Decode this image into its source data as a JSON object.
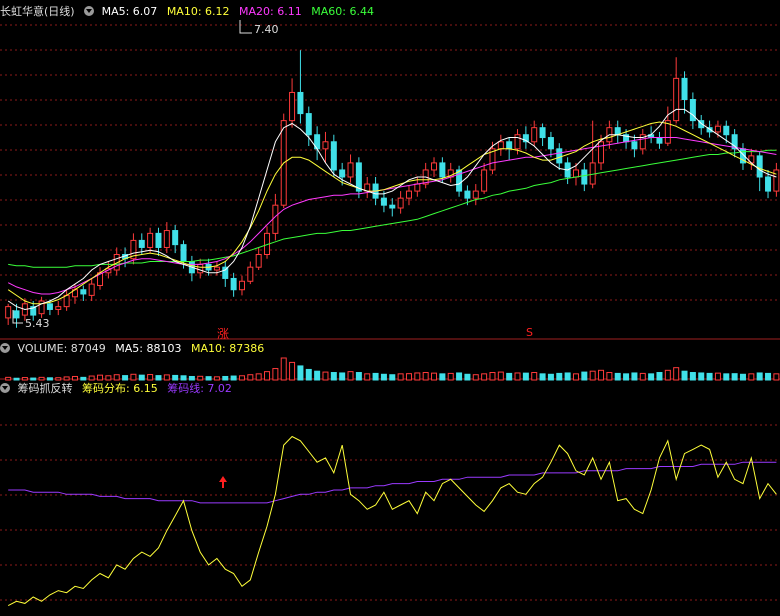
{
  "colors": {
    "up": "#ff3b3b",
    "down": "#40e0e8",
    "grid": "#8b1a1a",
    "ma5": "#ffffff",
    "ma10": "#ffff3a",
    "ma20": "#ff3aff",
    "ma60": "#3aff3a",
    "line_chip": "#ffff3a",
    "line_chipline": "#9a3aff",
    "label": "#dddddd",
    "signal": "#ff2020"
  },
  "price_panel": {
    "title": "长虹华意(日线)",
    "ma5_label": "MA5: 6.07",
    "ma10_label": "MA10: 6.12",
    "ma20_label": "MA20: 6.11",
    "ma60_label": "MA60: 6.44",
    "high_label": "7.40",
    "low_label": "5.43",
    "marker_zhang": "涨",
    "marker_s": "S"
  },
  "volume_panel": {
    "vol_label": "VOLUME: 87049",
    "ma5_label": "MA5: 88103",
    "ma10_label": "MA10: 87386"
  },
  "indicator_panel": {
    "name": "筹码抓反转",
    "chip_label": "筹码分布: 6.15",
    "chipline_label": "筹码线: 7.02"
  },
  "chart_data": {
    "type": "candlestick",
    "price_range": [
      5.4,
      7.6
    ],
    "candles": [
      [
        5.5,
        5.58,
        5.45,
        5.6
      ],
      [
        5.55,
        5.5,
        5.43,
        5.6
      ],
      [
        5.52,
        5.6,
        5.48,
        5.64
      ],
      [
        5.58,
        5.52,
        5.48,
        5.62
      ],
      [
        5.53,
        5.62,
        5.5,
        5.65
      ],
      [
        5.6,
        5.56,
        5.52,
        5.63
      ],
      [
        5.56,
        5.58,
        5.52,
        5.62
      ],
      [
        5.58,
        5.66,
        5.55,
        5.7
      ],
      [
        5.65,
        5.7,
        5.6,
        5.74
      ],
      [
        5.7,
        5.67,
        5.62,
        5.73
      ],
      [
        5.66,
        5.74,
        5.62,
        5.78
      ],
      [
        5.73,
        5.82,
        5.7,
        5.86
      ],
      [
        5.82,
        5.85,
        5.78,
        5.9
      ],
      [
        5.84,
        5.95,
        5.8,
        6.0
      ],
      [
        5.95,
        5.92,
        5.86,
        6.0
      ],
      [
        5.92,
        6.05,
        5.88,
        6.1
      ],
      [
        6.05,
        6.0,
        5.95,
        6.1
      ],
      [
        6.0,
        6.1,
        5.96,
        6.14
      ],
      [
        6.1,
        6.0,
        5.94,
        6.14
      ],
      [
        6.0,
        6.12,
        5.96,
        6.18
      ],
      [
        6.12,
        6.02,
        5.96,
        6.16
      ],
      [
        6.02,
        5.9,
        5.85,
        6.05
      ],
      [
        5.9,
        5.82,
        5.76,
        5.94
      ],
      [
        5.82,
        5.88,
        5.78,
        5.92
      ],
      [
        5.88,
        5.84,
        5.8,
        5.92
      ],
      [
        5.84,
        5.86,
        5.8,
        5.9
      ],
      [
        5.86,
        5.78,
        5.72,
        5.9
      ],
      [
        5.78,
        5.7,
        5.65,
        5.82
      ],
      [
        5.7,
        5.76,
        5.66,
        5.8
      ],
      [
        5.76,
        5.86,
        5.74,
        5.9
      ],
      [
        5.86,
        5.95,
        5.84,
        6.0
      ],
      [
        5.95,
        6.1,
        5.92,
        6.15
      ],
      [
        6.1,
        6.3,
        6.05,
        6.38
      ],
      [
        6.3,
        6.9,
        6.28,
        6.95
      ],
      [
        6.9,
        7.1,
        6.85,
        7.2
      ],
      [
        7.1,
        6.95,
        6.88,
        7.4
      ],
      [
        6.95,
        6.8,
        6.72,
        7.0
      ],
      [
        6.8,
        6.7,
        6.62,
        6.86
      ],
      [
        6.7,
        6.75,
        6.6,
        6.82
      ],
      [
        6.75,
        6.55,
        6.5,
        6.8
      ],
      [
        6.55,
        6.5,
        6.44,
        6.6
      ],
      [
        6.5,
        6.6,
        6.46,
        6.66
      ],
      [
        6.6,
        6.4,
        6.35,
        6.64
      ],
      [
        6.4,
        6.45,
        6.35,
        6.5
      ],
      [
        6.45,
        6.35,
        6.3,
        6.5
      ],
      [
        6.35,
        6.3,
        6.25,
        6.4
      ],
      [
        6.3,
        6.28,
        6.22,
        6.35
      ],
      [
        6.28,
        6.35,
        6.24,
        6.4
      ],
      [
        6.35,
        6.4,
        6.3,
        6.44
      ],
      [
        6.4,
        6.45,
        6.36,
        6.5
      ],
      [
        6.45,
        6.55,
        6.42,
        6.6
      ],
      [
        6.55,
        6.6,
        6.5,
        6.64
      ],
      [
        6.6,
        6.5,
        6.46,
        6.64
      ],
      [
        6.5,
        6.55,
        6.46,
        6.6
      ],
      [
        6.55,
        6.4,
        6.36,
        6.58
      ],
      [
        6.4,
        6.35,
        6.3,
        6.44
      ],
      [
        6.35,
        6.4,
        6.3,
        6.45
      ],
      [
        6.4,
        6.55,
        6.38,
        6.6
      ],
      [
        6.55,
        6.7,
        6.52,
        6.75
      ],
      [
        6.7,
        6.75,
        6.65,
        6.8
      ],
      [
        6.75,
        6.7,
        6.62,
        6.78
      ],
      [
        6.7,
        6.8,
        6.66,
        6.84
      ],
      [
        6.8,
        6.75,
        6.7,
        6.86
      ],
      [
        6.75,
        6.85,
        6.72,
        6.9
      ],
      [
        6.85,
        6.78,
        6.72,
        6.88
      ],
      [
        6.78,
        6.7,
        6.64,
        6.82
      ],
      [
        6.7,
        6.6,
        6.55,
        6.74
      ],
      [
        6.6,
        6.5,
        6.45,
        6.64
      ],
      [
        6.5,
        6.55,
        6.44,
        6.6
      ],
      [
        6.55,
        6.45,
        6.4,
        6.6
      ],
      [
        6.45,
        6.6,
        6.42,
        6.9
      ],
      [
        6.6,
        6.75,
        6.55,
        6.8
      ],
      [
        6.75,
        6.85,
        6.7,
        6.9
      ],
      [
        6.85,
        6.8,
        6.74,
        6.9
      ],
      [
        6.8,
        6.75,
        6.7,
        6.84
      ],
      [
        6.75,
        6.7,
        6.64,
        6.8
      ],
      [
        6.7,
        6.8,
        6.66,
        6.84
      ],
      [
        6.8,
        6.78,
        6.74,
        6.86
      ],
      [
        6.78,
        6.74,
        6.7,
        6.82
      ],
      [
        6.74,
        6.9,
        6.72,
        7.0
      ],
      [
        6.9,
        7.2,
        6.88,
        7.35
      ],
      [
        7.2,
        7.05,
        6.95,
        7.25
      ],
      [
        7.05,
        6.9,
        6.84,
        7.1
      ],
      [
        6.9,
        6.85,
        6.8,
        6.94
      ],
      [
        6.85,
        6.82,
        6.78,
        6.9
      ],
      [
        6.82,
        6.86,
        6.78,
        6.9
      ],
      [
        6.86,
        6.8,
        6.74,
        6.9
      ],
      [
        6.8,
        6.7,
        6.64,
        6.84
      ],
      [
        6.7,
        6.6,
        6.55,
        6.74
      ],
      [
        6.6,
        6.65,
        6.55,
        6.7
      ],
      [
        6.65,
        6.5,
        6.4,
        6.68
      ],
      [
        6.5,
        6.4,
        6.35,
        6.55
      ],
      [
        6.4,
        6.55,
        6.36,
        6.6
      ]
    ],
    "ma5": [
      5.62,
      5.58,
      5.56,
      5.57,
      5.6,
      5.62,
      5.65,
      5.7,
      5.74,
      5.78,
      5.84,
      5.88,
      5.9,
      5.92,
      5.94,
      5.96,
      5.97,
      5.98,
      5.97,
      5.94,
      5.9,
      5.88,
      5.86,
      5.84,
      5.82,
      5.82,
      5.84,
      5.9,
      6.0,
      6.15,
      6.35,
      6.55,
      6.75,
      6.85,
      6.88,
      6.84,
      6.78,
      6.7,
      6.6,
      6.52,
      6.48,
      6.45,
      6.42,
      6.4,
      6.38,
      6.38,
      6.4,
      6.44,
      6.48,
      6.5,
      6.5,
      6.48,
      6.46,
      6.44,
      6.45,
      6.5,
      6.58,
      6.66,
      6.72,
      6.76,
      6.78,
      6.78,
      6.76,
      6.72,
      6.66,
      6.6,
      6.56,
      6.55,
      6.58,
      6.64,
      6.7,
      6.76,
      6.8,
      6.8,
      6.79,
      6.78,
      6.78,
      6.8,
      6.86,
      6.94,
      6.98,
      6.98,
      6.94,
      6.88,
      6.84,
      6.8,
      6.76,
      6.72,
      6.66,
      6.6,
      6.55,
      6.52,
      6.5
    ],
    "ma10": [
      5.7,
      5.66,
      5.62,
      5.6,
      5.6,
      5.61,
      5.63,
      5.66,
      5.7,
      5.74,
      5.78,
      5.82,
      5.86,
      5.89,
      5.92,
      5.94,
      5.95,
      5.96,
      5.95,
      5.93,
      5.91,
      5.89,
      5.87,
      5.86,
      5.86,
      5.87,
      5.9,
      5.96,
      6.04,
      6.14,
      6.26,
      6.4,
      6.52,
      6.6,
      6.64,
      6.64,
      6.62,
      6.58,
      6.54,
      6.5,
      6.46,
      6.44,
      6.42,
      6.4,
      6.4,
      6.41,
      6.43,
      6.45,
      6.47,
      6.48,
      6.48,
      6.48,
      6.49,
      6.51,
      6.54,
      6.58,
      6.62,
      6.66,
      6.68,
      6.7,
      6.7,
      6.69,
      6.67,
      6.64,
      6.62,
      6.62,
      6.64,
      6.66,
      6.68,
      6.72,
      6.75,
      6.77,
      6.78,
      6.8,
      6.82,
      6.84,
      6.86,
      6.88,
      6.89,
      6.88,
      6.86,
      6.83,
      6.8,
      6.77,
      6.74,
      6.71,
      6.68,
      6.65,
      6.62,
      6.59,
      6.56,
      6.54,
      6.52
    ],
    "ma20": [
      5.75,
      5.72,
      5.7,
      5.68,
      5.67,
      5.67,
      5.68,
      5.7,
      5.72,
      5.75,
      5.78,
      5.81,
      5.84,
      5.87,
      5.89,
      5.91,
      5.92,
      5.92,
      5.91,
      5.9,
      5.89,
      5.88,
      5.88,
      5.88,
      5.89,
      5.9,
      5.92,
      5.95,
      5.99,
      6.04,
      6.1,
      6.16,
      6.22,
      6.27,
      6.3,
      6.32,
      6.34,
      6.35,
      6.36,
      6.37,
      6.37,
      6.38,
      6.38,
      6.39,
      6.4,
      6.41,
      6.42,
      6.43,
      6.44,
      6.45,
      6.46,
      6.47,
      6.48,
      6.5,
      6.52,
      6.54,
      6.56,
      6.58,
      6.6,
      6.61,
      6.62,
      6.63,
      6.64,
      6.64,
      6.65,
      6.66,
      6.67,
      6.68,
      6.69,
      6.7,
      6.71,
      6.72,
      6.73,
      6.74,
      6.75,
      6.76,
      6.77,
      6.78,
      6.78,
      6.78,
      6.78,
      6.77,
      6.76,
      6.75,
      6.74,
      6.73,
      6.72,
      6.71,
      6.7,
      6.69,
      6.68,
      6.67,
      6.66
    ],
    "ma60": [
      5.88,
      5.87,
      5.87,
      5.86,
      5.86,
      5.86,
      5.86,
      5.86,
      5.87,
      5.87,
      5.87,
      5.88,
      5.88,
      5.88,
      5.89,
      5.89,
      5.89,
      5.9,
      5.9,
      5.9,
      5.9,
      5.9,
      5.9,
      5.91,
      5.91,
      5.92,
      5.93,
      5.94,
      5.96,
      5.98,
      6.0,
      6.02,
      6.04,
      6.06,
      6.07,
      6.08,
      6.09,
      6.1,
      6.1,
      6.11,
      6.12,
      6.12,
      6.13,
      6.14,
      6.15,
      6.16,
      6.17,
      6.18,
      6.19,
      6.2,
      6.22,
      6.24,
      6.26,
      6.28,
      6.3,
      6.32,
      6.34,
      6.35,
      6.37,
      6.38,
      6.4,
      6.41,
      6.42,
      6.44,
      6.45,
      6.46,
      6.48,
      6.49,
      6.5,
      6.51,
      6.52,
      6.53,
      6.54,
      6.55,
      6.56,
      6.57,
      6.58,
      6.59,
      6.6,
      6.61,
      6.62,
      6.63,
      6.64,
      6.65,
      6.66,
      6.66,
      6.67,
      6.67,
      6.68,
      6.68,
      6.68,
      6.69,
      6.69
    ],
    "volume": [
      30,
      20,
      28,
      22,
      30,
      25,
      26,
      35,
      40,
      30,
      45,
      55,
      48,
      60,
      50,
      65,
      55,
      62,
      50,
      58,
      52,
      48,
      40,
      42,
      38,
      36,
      40,
      45,
      48,
      60,
      70,
      95,
      130,
      250,
      200,
      160,
      120,
      100,
      90,
      85,
      80,
      95,
      85,
      70,
      75,
      65,
      60,
      70,
      72,
      80,
      85,
      78,
      70,
      75,
      80,
      65,
      60,
      70,
      85,
      90,
      75,
      80,
      78,
      85,
      70,
      65,
      75,
      80,
      70,
      90,
      100,
      110,
      85,
      75,
      70,
      80,
      75,
      70,
      85,
      110,
      140,
      100,
      85,
      80,
      75,
      78,
      70,
      72,
      65,
      70,
      80,
      75,
      70
    ],
    "chip": [
      3,
      5,
      4,
      7,
      5,
      8,
      10,
      9,
      12,
      11,
      15,
      18,
      16,
      22,
      20,
      25,
      28,
      26,
      30,
      38,
      45,
      52,
      38,
      28,
      22,
      25,
      20,
      18,
      12,
      15,
      28,
      40,
      55,
      78,
      82,
      80,
      75,
      70,
      72,
      65,
      78,
      55,
      52,
      48,
      50,
      56,
      48,
      50,
      52,
      46,
      56,
      52,
      60,
      62,
      58,
      54,
      50,
      47,
      52,
      58,
      60,
      56,
      55,
      60,
      63,
      70,
      78,
      74,
      66,
      64,
      72,
      62,
      70,
      52,
      53,
      48,
      46,
      57,
      72,
      80,
      62,
      74,
      76,
      78,
      76,
      63,
      70,
      62,
      60,
      72,
      53,
      60,
      55
    ],
    "chipline": [
      57,
      57,
      57,
      56,
      56,
      56,
      56,
      55,
      55,
      55,
      55,
      54,
      54,
      54,
      53,
      53,
      53,
      53,
      52,
      52,
      52,
      52,
      52,
      51,
      51,
      51,
      51,
      51,
      51,
      51,
      51,
      51,
      52,
      53,
      54,
      55,
      55,
      56,
      56,
      57,
      57,
      58,
      58,
      58,
      59,
      59,
      60,
      60,
      60,
      61,
      61,
      61,
      62,
      62,
      62,
      63,
      63,
      63,
      63,
      63,
      64,
      64,
      64,
      64,
      65,
      65,
      65,
      65,
      65,
      66,
      66,
      66,
      66,
      66,
      67,
      67,
      67,
      67,
      68,
      68,
      68,
      68,
      68,
      69,
      69,
      69,
      69,
      69,
      70,
      70,
      70,
      70,
      70
    ]
  }
}
